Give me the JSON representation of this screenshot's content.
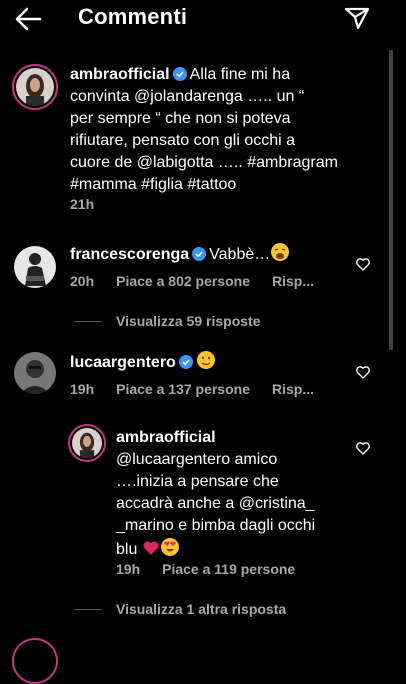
{
  "header": {
    "title": "Commenti",
    "back_icon": "arrow-left-icon",
    "send_icon": "paper-plane-icon"
  },
  "caption": {
    "username": "ambraofficial",
    "line1": "Alla fine mi ha",
    "line2": "convinta @jolandarenga ….. un “",
    "line3": "per sempre “ che non si poteva",
    "line4": "rifiutare, pensato con gli occhi a",
    "line5": "cuore de @labigotta ….. #ambragram",
    "line6": "#mamma #figlia #tattoo",
    "time": "21h"
  },
  "comments": [
    {
      "username": "francescorenga",
      "text": "Vabbè…",
      "emoji": "weary-face",
      "time": "20h",
      "likes": "Piace a 802 persone",
      "reply": "Risp...",
      "view_replies": "Visualizza 59 risposte"
    },
    {
      "username": "lucaargentero",
      "text": "",
      "emoji": "smiling-face-with-hearts",
      "time": "19h",
      "likes": "Piace a 137 persone",
      "reply": "Risp...",
      "view_replies": "Visualizza 1 altra risposta"
    }
  ],
  "reply": {
    "username": "ambraofficial",
    "line1": "@lucaargentero amico",
    "line2": "….inizia a pensare che",
    "line3": "accadrà anche a @cristina_",
    "line4": "_marino e bimba dagli occhi",
    "line5": "blu",
    "emoji": "red-heart heart-eyes",
    "time": "19h",
    "likes": "Piace a 119 persone"
  },
  "colors": {
    "background": "#000000",
    "text": "#ffffff",
    "meta": "#a8a8a8",
    "verified": "#3897f0",
    "story_ring": "#c13584",
    "heart": "#ed4956"
  }
}
